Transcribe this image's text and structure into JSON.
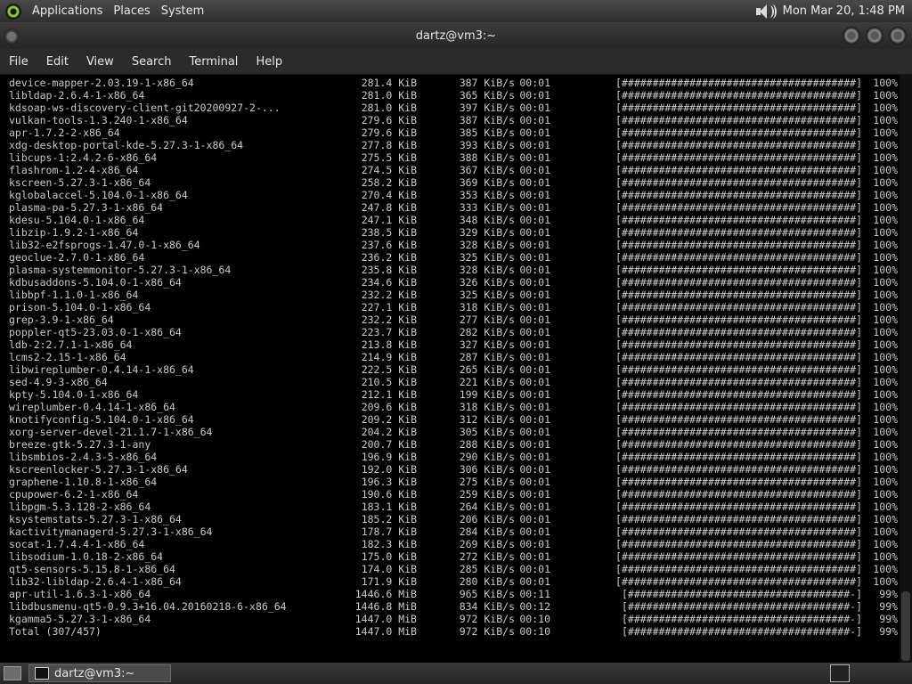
{
  "top_panel": {
    "menus": [
      "Applications",
      "Places",
      "System"
    ],
    "clock": "Mon Mar 20,  1:48 PM"
  },
  "window": {
    "title": "dartz@vm3:~"
  },
  "menubar": {
    "items": [
      "File",
      "Edit",
      "View",
      "Search",
      "Terminal",
      "Help"
    ]
  },
  "terminal": {
    "lines": [
      {
        "name": "device-mapper-2.03.19-1-x86_64",
        "size": "281.4 KiB",
        "rate": "387 KiB/s",
        "time": "00:01",
        "bar": "[######################################]",
        "pct": "100%"
      },
      {
        "name": "libldap-2.6.4-1-x86_64",
        "size": "281.0 KiB",
        "rate": "365 KiB/s",
        "time": "00:01",
        "bar": "[######################################]",
        "pct": "100%"
      },
      {
        "name": "kdsoap-ws-discovery-client-git20200927-2-...",
        "size": "281.0 KiB",
        "rate": "397 KiB/s",
        "time": "00:01",
        "bar": "[######################################]",
        "pct": "100%"
      },
      {
        "name": "vulkan-tools-1.3.240-1-x86_64",
        "size": "279.6 KiB",
        "rate": "387 KiB/s",
        "time": "00:01",
        "bar": "[######################################]",
        "pct": "100%"
      },
      {
        "name": "apr-1.7.2-2-x86_64",
        "size": "279.6 KiB",
        "rate": "385 KiB/s",
        "time": "00:01",
        "bar": "[######################################]",
        "pct": "100%"
      },
      {
        "name": "xdg-desktop-portal-kde-5.27.3-1-x86_64",
        "size": "277.8 KiB",
        "rate": "393 KiB/s",
        "time": "00:01",
        "bar": "[######################################]",
        "pct": "100%"
      },
      {
        "name": "libcups-1:2.4.2-6-x86_64",
        "size": "275.5 KiB",
        "rate": "388 KiB/s",
        "time": "00:01",
        "bar": "[######################################]",
        "pct": "100%"
      },
      {
        "name": "flashrom-1.2-4-x86_64",
        "size": "274.5 KiB",
        "rate": "367 KiB/s",
        "time": "00:01",
        "bar": "[######################################]",
        "pct": "100%"
      },
      {
        "name": "kscreen-5.27.3-1-x86_64",
        "size": "258.2 KiB",
        "rate": "369 KiB/s",
        "time": "00:01",
        "bar": "[######################################]",
        "pct": "100%"
      },
      {
        "name": "kglobalaccel-5.104.0-1-x86_64",
        "size": "270.4 KiB",
        "rate": "353 KiB/s",
        "time": "00:01",
        "bar": "[######################################]",
        "pct": "100%"
      },
      {
        "name": "plasma-pa-5.27.3-1-x86_64",
        "size": "247.8 KiB",
        "rate": "333 KiB/s",
        "time": "00:01",
        "bar": "[######################################]",
        "pct": "100%"
      },
      {
        "name": "kdesu-5.104.0-1-x86_64",
        "size": "247.1 KiB",
        "rate": "348 KiB/s",
        "time": "00:01",
        "bar": "[######################################]",
        "pct": "100%"
      },
      {
        "name": "libzip-1.9.2-1-x86_64",
        "size": "238.5 KiB",
        "rate": "329 KiB/s",
        "time": "00:01",
        "bar": "[######################################]",
        "pct": "100%"
      },
      {
        "name": "lib32-e2fsprogs-1.47.0-1-x86_64",
        "size": "237.6 KiB",
        "rate": "328 KiB/s",
        "time": "00:01",
        "bar": "[######################################]",
        "pct": "100%"
      },
      {
        "name": "geoclue-2.7.0-1-x86_64",
        "size": "236.2 KiB",
        "rate": "325 KiB/s",
        "time": "00:01",
        "bar": "[######################################]",
        "pct": "100%"
      },
      {
        "name": "plasma-systemmonitor-5.27.3-1-x86_64",
        "size": "235.8 KiB",
        "rate": "328 KiB/s",
        "time": "00:01",
        "bar": "[######################################]",
        "pct": "100%"
      },
      {
        "name": "kdbusaddons-5.104.0-1-x86_64",
        "size": "234.6 KiB",
        "rate": "326 KiB/s",
        "time": "00:01",
        "bar": "[######################################]",
        "pct": "100%"
      },
      {
        "name": "libbpf-1.1.0-1-x86_64",
        "size": "232.2 KiB",
        "rate": "325 KiB/s",
        "time": "00:01",
        "bar": "[######################################]",
        "pct": "100%"
      },
      {
        "name": "prison-5.104.0-1-x86_64",
        "size": "227.1 KiB",
        "rate": "318 KiB/s",
        "time": "00:01",
        "bar": "[######################################]",
        "pct": "100%"
      },
      {
        "name": "grep-3.9-1-x86_64",
        "size": "232.2 KiB",
        "rate": "277 KiB/s",
        "time": "00:01",
        "bar": "[######################################]",
        "pct": "100%"
      },
      {
        "name": "poppler-qt5-23.03.0-1-x86_64",
        "size": "223.7 KiB",
        "rate": "282 KiB/s",
        "time": "00:01",
        "bar": "[######################################]",
        "pct": "100%"
      },
      {
        "name": "ldb-2:2.7.1-1-x86_64",
        "size": "213.8 KiB",
        "rate": "327 KiB/s",
        "time": "00:01",
        "bar": "[######################################]",
        "pct": "100%"
      },
      {
        "name": "lcms2-2.15-1-x86_64",
        "size": "214.9 KiB",
        "rate": "287 KiB/s",
        "time": "00:01",
        "bar": "[######################################]",
        "pct": "100%"
      },
      {
        "name": "libwireplumber-0.4.14-1-x86_64",
        "size": "222.5 KiB",
        "rate": "265 KiB/s",
        "time": "00:01",
        "bar": "[######################################]",
        "pct": "100%"
      },
      {
        "name": "sed-4.9-3-x86_64",
        "size": "210.5 KiB",
        "rate": "221 KiB/s",
        "time": "00:01",
        "bar": "[######################################]",
        "pct": "100%"
      },
      {
        "name": "kpty-5.104.0-1-x86_64",
        "size": "212.1 KiB",
        "rate": "199 KiB/s",
        "time": "00:01",
        "bar": "[######################################]",
        "pct": "100%"
      },
      {
        "name": "wireplumber-0.4.14-1-x86_64",
        "size": "209.6 KiB",
        "rate": "318 KiB/s",
        "time": "00:01",
        "bar": "[######################################]",
        "pct": "100%"
      },
      {
        "name": "knotifyconfig-5.104.0-1-x86_64",
        "size": "209.2 KiB",
        "rate": "312 KiB/s",
        "time": "00:01",
        "bar": "[######################################]",
        "pct": "100%"
      },
      {
        "name": "xorg-server-devel-21.1.7-1-x86_64",
        "size": "204.2 KiB",
        "rate": "305 KiB/s",
        "time": "00:01",
        "bar": "[######################################]",
        "pct": "100%"
      },
      {
        "name": "breeze-gtk-5.27.3-1-any",
        "size": "200.7 KiB",
        "rate": "288 KiB/s",
        "time": "00:01",
        "bar": "[######################################]",
        "pct": "100%"
      },
      {
        "name": "libsmbios-2.4.3-5-x86_64",
        "size": "196.9 KiB",
        "rate": "290 KiB/s",
        "time": "00:01",
        "bar": "[######################################]",
        "pct": "100%"
      },
      {
        "name": "kscreenlocker-5.27.3-1-x86_64",
        "size": "192.0 KiB",
        "rate": "306 KiB/s",
        "time": "00:01",
        "bar": "[######################################]",
        "pct": "100%"
      },
      {
        "name": "graphene-1.10.8-1-x86_64",
        "size": "196.3 KiB",
        "rate": "275 KiB/s",
        "time": "00:01",
        "bar": "[######################################]",
        "pct": "100%"
      },
      {
        "name": "cpupower-6.2-1-x86_64",
        "size": "190.6 KiB",
        "rate": "259 KiB/s",
        "time": "00:01",
        "bar": "[######################################]",
        "pct": "100%"
      },
      {
        "name": "libpgm-5.3.128-2-x86_64",
        "size": "183.1 KiB",
        "rate": "264 KiB/s",
        "time": "00:01",
        "bar": "[######################################]",
        "pct": "100%"
      },
      {
        "name": "ksystemstats-5.27.3-1-x86_64",
        "size": "185.2 KiB",
        "rate": "206 KiB/s",
        "time": "00:01",
        "bar": "[######################################]",
        "pct": "100%"
      },
      {
        "name": "kactivitymanagerd-5.27.3-1-x86_64",
        "size": "178.7 KiB",
        "rate": "284 KiB/s",
        "time": "00:01",
        "bar": "[######################################]",
        "pct": "100%"
      },
      {
        "name": "socat-1.7.4.4-1-x86_64",
        "size": "182.3 KiB",
        "rate": "269 KiB/s",
        "time": "00:01",
        "bar": "[######################################]",
        "pct": "100%"
      },
      {
        "name": "libsodium-1.0.18-2-x86_64",
        "size": "175.0 KiB",
        "rate": "272 KiB/s",
        "time": "00:01",
        "bar": "[######################################]",
        "pct": "100%"
      },
      {
        "name": "qt5-sensors-5.15.8-1-x86_64",
        "size": "174.0 KiB",
        "rate": "285 KiB/s",
        "time": "00:01",
        "bar": "[######################################]",
        "pct": "100%"
      },
      {
        "name": "lib32-libldap-2.6.4-1-x86_64",
        "size": "171.9 KiB",
        "rate": "280 KiB/s",
        "time": "00:01",
        "bar": "[######################################]",
        "pct": "100%"
      },
      {
        "name": "apr-util-1.6.3-1-x86_64",
        "size": "1446.6 MiB",
        "rate": "965 KiB/s",
        "time": "00:11",
        "bar": "[####################################-]",
        "pct": "99%"
      },
      {
        "name": "libdbusmenu-qt5-0.9.3+16.04.20160218-6-x86_64",
        "size": "1446.8 MiB",
        "rate": "834 KiB/s",
        "time": "00:12",
        "bar": "[####################################-]",
        "pct": "99%"
      },
      {
        "name": "kgamma5-5.27.3-1-x86_64",
        "size": "1447.0 MiB",
        "rate": "972 KiB/s",
        "time": "00:10",
        "bar": "[####################################-]",
        "pct": "99%"
      },
      {
        "name": "Total (307/457)",
        "size": "1447.0 MiB",
        "rate": "972 KiB/s",
        "time": "00:10",
        "bar": "[####################################-]",
        "pct": "99%"
      }
    ]
  },
  "taskbar": {
    "window_button": "dartz@vm3:~"
  }
}
